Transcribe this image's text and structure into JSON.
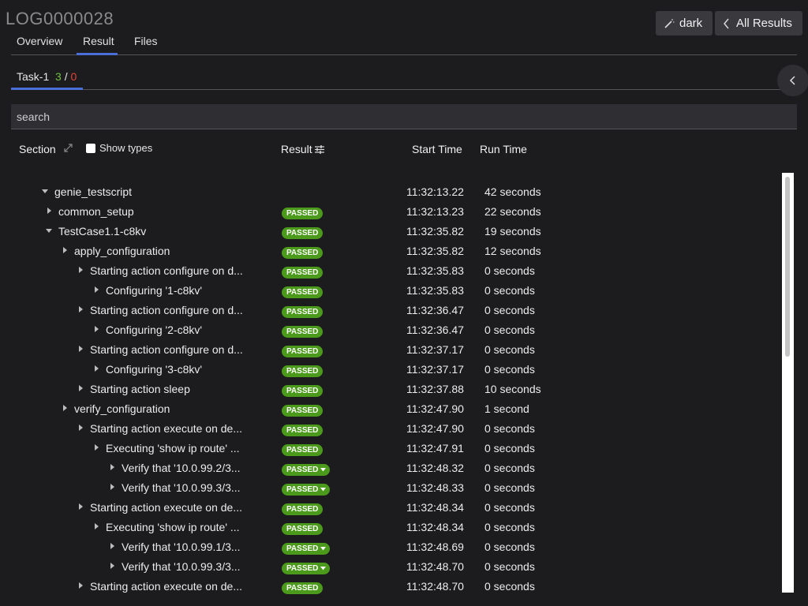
{
  "header": {
    "title": "LOG0000028",
    "theme_label": "dark",
    "all_results_label": "All Results"
  },
  "tabs": [
    "Overview",
    "Result",
    "Files"
  ],
  "task": {
    "name": "Task-1",
    "passed": "3",
    "sep": "/",
    "failed": "0"
  },
  "search": {
    "placeholder": "search"
  },
  "columns": {
    "section": "Section",
    "show_types": "Show types",
    "result": "Result",
    "start": "Start Time",
    "run": "Run Time"
  },
  "rows": [
    {
      "name": "genie_testscript",
      "level": 0,
      "open": true,
      "result": "",
      "dd": false,
      "start": "11:32:13.22",
      "run": "42 seconds"
    },
    {
      "name": "common_setup",
      "level": 1,
      "open": false,
      "result": "PASSED",
      "dd": false,
      "start": "11:32:13.23",
      "run": "22 seconds"
    },
    {
      "name": "TestCase1.1-c8kv",
      "level": 1,
      "open": true,
      "result": "PASSED",
      "dd": false,
      "start": "11:32:35.82",
      "run": "19 seconds"
    },
    {
      "name": "apply_configuration",
      "level": 2,
      "open": false,
      "result": "PASSED",
      "dd": false,
      "start": "11:32:35.82",
      "run": "12 seconds"
    },
    {
      "name": "Starting action configure on d...",
      "level": 3,
      "open": false,
      "result": "PASSED",
      "dd": false,
      "start": "11:32:35.83",
      "run": "0 seconds"
    },
    {
      "name": "Configuring '1-c8kv'",
      "level": 4,
      "open": false,
      "result": "PASSED",
      "dd": false,
      "start": "11:32:35.83",
      "run": "0 seconds"
    },
    {
      "name": "Starting action configure on d...",
      "level": 3,
      "open": false,
      "result": "PASSED",
      "dd": false,
      "start": "11:32:36.47",
      "run": "0 seconds"
    },
    {
      "name": "Configuring '2-c8kv'",
      "level": 4,
      "open": false,
      "result": "PASSED",
      "dd": false,
      "start": "11:32:36.47",
      "run": "0 seconds"
    },
    {
      "name": "Starting action configure on d...",
      "level": 3,
      "open": false,
      "result": "PASSED",
      "dd": false,
      "start": "11:32:37.17",
      "run": "0 seconds"
    },
    {
      "name": "Configuring '3-c8kv'",
      "level": 4,
      "open": false,
      "result": "PASSED",
      "dd": false,
      "start": "11:32:37.17",
      "run": "0 seconds"
    },
    {
      "name": "Starting action sleep",
      "level": 3,
      "open": false,
      "result": "PASSED",
      "dd": false,
      "start": "11:32:37.88",
      "run": "10 seconds"
    },
    {
      "name": "verify_configuration",
      "level": 2,
      "open": false,
      "result": "PASSED",
      "dd": false,
      "start": "11:32:47.90",
      "run": "1 second"
    },
    {
      "name": "Starting action execute on de...",
      "level": 3,
      "open": false,
      "result": "PASSED",
      "dd": false,
      "start": "11:32:47.90",
      "run": "0 seconds"
    },
    {
      "name": "Executing 'show ip route' ...",
      "level": 4,
      "open": false,
      "result": "PASSED",
      "dd": false,
      "start": "11:32:47.91",
      "run": "0 seconds"
    },
    {
      "name": "Verify that '10.0.99.2/3...",
      "level": 5,
      "open": false,
      "result": "PASSED",
      "dd": true,
      "start": "11:32:48.32",
      "run": "0 seconds"
    },
    {
      "name": "Verify that '10.0.99.3/3...",
      "level": 5,
      "open": false,
      "result": "PASSED",
      "dd": true,
      "start": "11:32:48.33",
      "run": "0 seconds"
    },
    {
      "name": "Starting action execute on de...",
      "level": 3,
      "open": false,
      "result": "PASSED",
      "dd": false,
      "start": "11:32:48.34",
      "run": "0 seconds"
    },
    {
      "name": "Executing 'show ip route' ...",
      "level": 4,
      "open": false,
      "result": "PASSED",
      "dd": false,
      "start": "11:32:48.34",
      "run": "0 seconds"
    },
    {
      "name": "Verify that '10.0.99.1/3...",
      "level": 5,
      "open": false,
      "result": "PASSED",
      "dd": true,
      "start": "11:32:48.69",
      "run": "0 seconds"
    },
    {
      "name": "Verify that '10.0.99.3/3...",
      "level": 5,
      "open": false,
      "result": "PASSED",
      "dd": true,
      "start": "11:32:48.70",
      "run": "0 seconds"
    },
    {
      "name": "Starting action execute on de...",
      "level": 3,
      "open": false,
      "result": "PASSED",
      "dd": false,
      "start": "11:32:48.70",
      "run": "0 seconds"
    }
  ]
}
